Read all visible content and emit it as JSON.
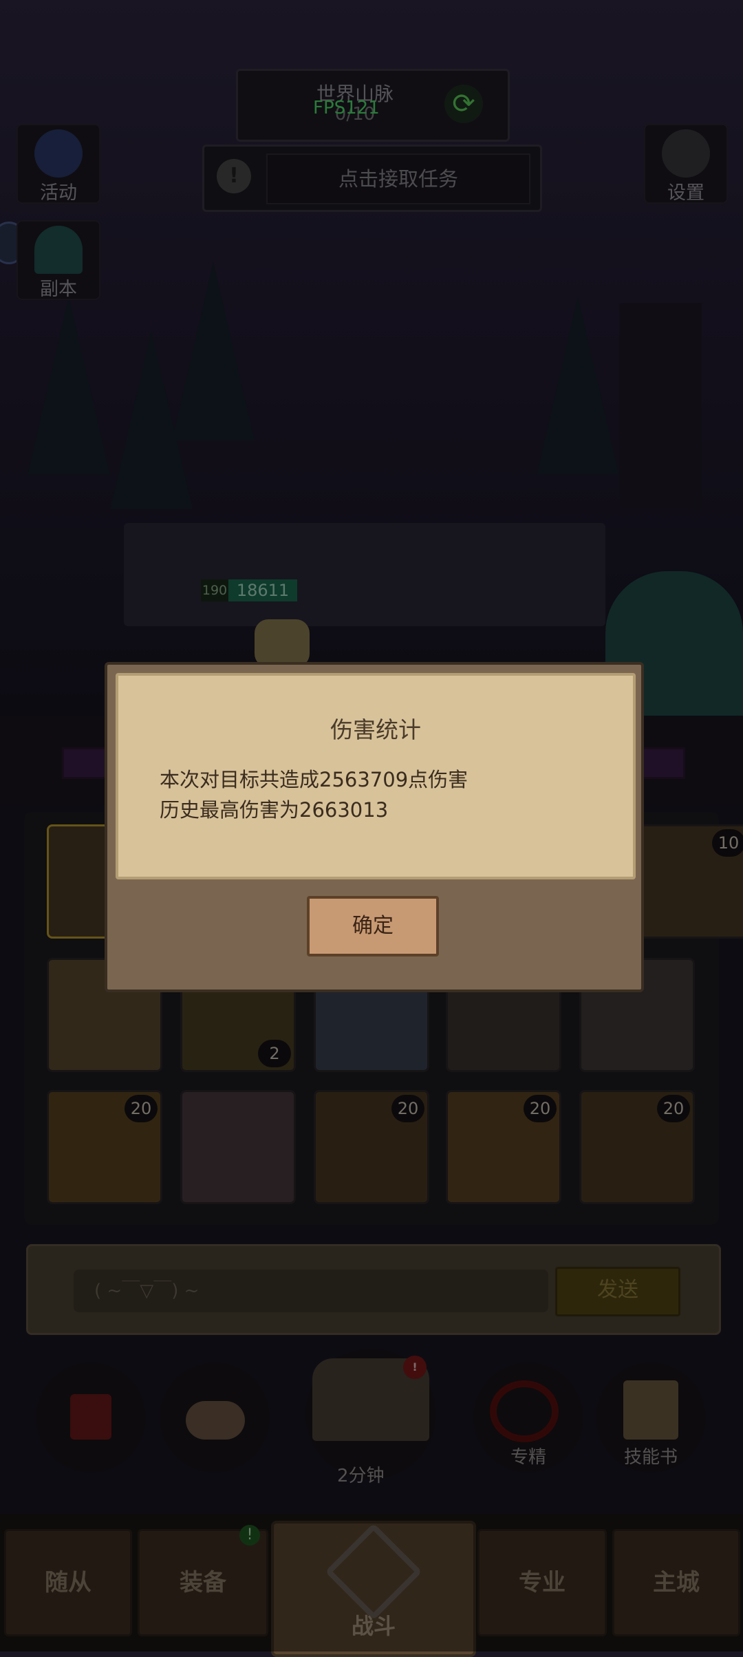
{
  "top": {
    "location": "世界山脉",
    "progress": "0/10",
    "fps": "FPS121",
    "quest_button": "点击接取任务"
  },
  "side": {
    "activity": "活动",
    "dungeon": "副本",
    "settings": "设置"
  },
  "enemy": {
    "level": "190",
    "hp": "18611"
  },
  "skills": {
    "badges": [
      "10",
      "2",
      "20",
      "20",
      "20",
      "20"
    ]
  },
  "chat": {
    "placeholder": "( ~￣▽￣) ~",
    "send": "发送"
  },
  "actions": {
    "chest_time": "2分钟",
    "specialize": "专精",
    "skill_book": "技能书",
    "chest_alert": "!"
  },
  "nav": {
    "followers": "随从",
    "equipment": "装备",
    "battle": "战斗",
    "profession": "专业",
    "main_city": "主城",
    "equipment_badge": "!"
  },
  "dialog": {
    "title": "伤害统计",
    "line1": "本次对目标共造成2563709点伤害",
    "line2": "历史最高伤害为2663013",
    "confirm": "确定"
  }
}
